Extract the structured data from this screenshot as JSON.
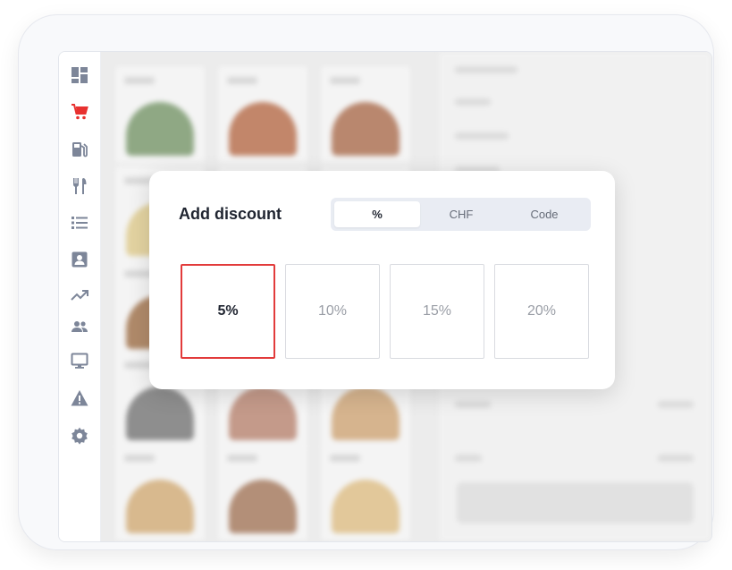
{
  "sidebar": {
    "items": [
      {
        "icon": "dashboard-icon"
      },
      {
        "icon": "cart-icon",
        "active": true
      },
      {
        "icon": "fuel-pump-icon"
      },
      {
        "icon": "fork-knife-icon"
      },
      {
        "icon": "list-icon"
      },
      {
        "icon": "contact-card-icon"
      },
      {
        "icon": "trending-up-icon"
      },
      {
        "icon": "people-icon"
      },
      {
        "icon": "monitor-icon"
      },
      {
        "icon": "warning-icon"
      },
      {
        "icon": "settings-gear-icon"
      }
    ],
    "active_color": "#e8312f",
    "icon_color": "#7d8699"
  },
  "modal": {
    "title": "Add discount",
    "tabs": [
      {
        "label": "%",
        "active": true
      },
      {
        "label": "CHF",
        "active": false
      },
      {
        "label": "Code",
        "active": false
      }
    ],
    "options": [
      {
        "label": "5%",
        "selected": true
      },
      {
        "label": "10%",
        "selected": false
      },
      {
        "label": "15%",
        "selected": false
      },
      {
        "label": "20%",
        "selected": false
      }
    ],
    "selected_border_color": "#e23b3b"
  }
}
